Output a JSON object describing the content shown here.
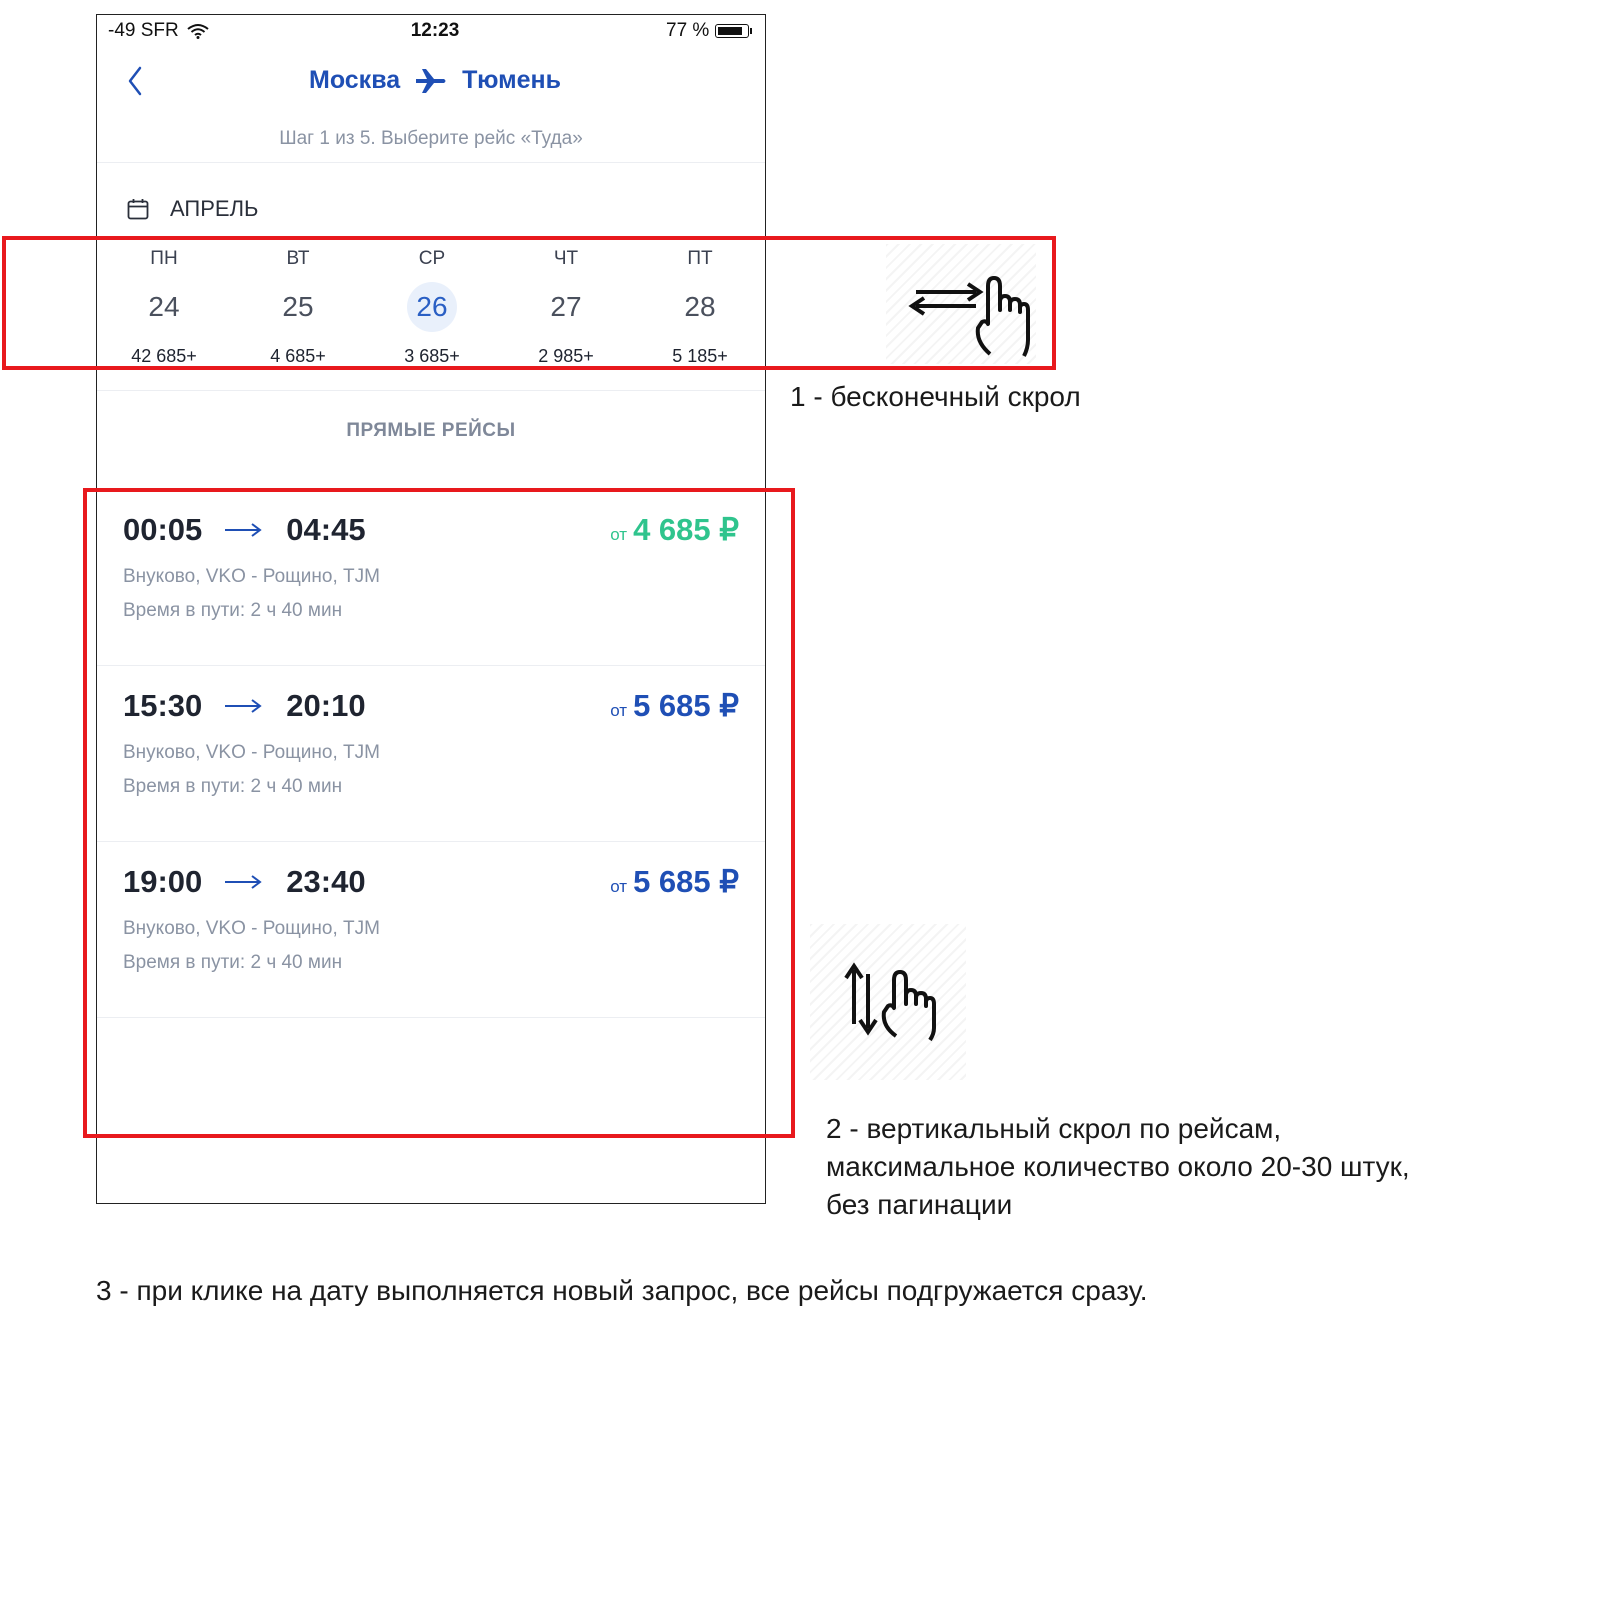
{
  "status_bar": {
    "carrier": "-49 SFR",
    "time": "12:23",
    "battery": "77 %"
  },
  "header": {
    "origin": "Москва",
    "destination": "Тюмень",
    "step": "Шаг 1 из 5. Выберите рейс «Туда»"
  },
  "calendar": {
    "month": "АПРЕЛЬ",
    "days": [
      {
        "dow": "ПН",
        "num": "24",
        "price": "42 685+"
      },
      {
        "dow": "ВТ",
        "num": "25",
        "price": "4 685+"
      },
      {
        "dow": "СР",
        "num": "26",
        "price": "3 685+",
        "selected": true
      },
      {
        "dow": "ЧТ",
        "num": "27",
        "price": "2 985+"
      },
      {
        "dow": "ПТ",
        "num": "28",
        "price": "5 185+"
      }
    ]
  },
  "section_title": "ПРЯМЫЕ РЕЙСЫ",
  "flights": [
    {
      "dep": "00:05",
      "arr": "04:45",
      "price_prefix": "от",
      "price": "4 685 ₽",
      "route": "Внуково, VKO - Рощино, TJM",
      "duration": "Время в пути: 2 ч 40 мин",
      "price_color": "#2fc48d"
    },
    {
      "dep": "15:30",
      "arr": "20:10",
      "price_prefix": "от",
      "price": "5 685 ₽",
      "route": "Внуково, VKO - Рощино, TJM",
      "duration": "Время в пути: 2 ч 40 мин",
      "price_color": "#1f4fb5"
    },
    {
      "dep": "19:00",
      "arr": "23:40",
      "price_prefix": "от",
      "price": "5 685 ₽",
      "route": "Внуково, VKO - Рощино, TJM",
      "duration": "Время в пути: 2 ч 40 мин",
      "price_color": "#1f4fb5"
    }
  ],
  "annotations": {
    "note1": "1 - бесконечный скрол",
    "note2_lines": [
      "2 - вертикальный скрол по рейсам,",
      "максимальное количество около 20-30 штук,",
      "без пагинации"
    ],
    "note3": "3 - при клике на дату выполняется новый запрос, все рейсы подгружается сразу."
  },
  "colors": {
    "accent": "#1f4fb5",
    "green_price": "#2fc48d",
    "highlight_box": "#e8191d",
    "selected_day_bg": "#e9f0fb"
  },
  "icons": {
    "back": "chevron-left-icon",
    "plane": "airplane-icon",
    "calendar": "calendar-icon",
    "wifi": "wifi-icon",
    "battery": "battery-icon",
    "swipe_horizontal": "swipe-horizontal-icon",
    "swipe_vertical": "swipe-vertical-icon"
  }
}
